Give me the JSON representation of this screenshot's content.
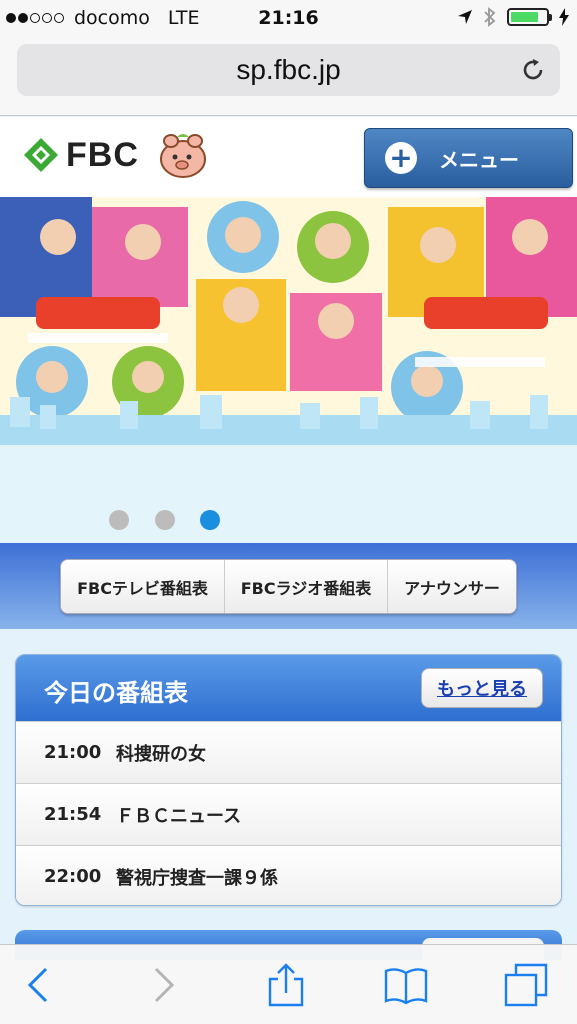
{
  "status_bar": {
    "carrier": "docomo",
    "network": "LTE",
    "time": "21:16",
    "signal_bars_filled": 2,
    "signal_bars_total": 5,
    "battery_level": 0.8
  },
  "browser": {
    "url": "sp.fbc.jp"
  },
  "header": {
    "logo_text": "FBC",
    "menu_label": "メニュー"
  },
  "banner": {
    "slides_total": 3,
    "active_slide": 3
  },
  "nav": {
    "items": [
      {
        "label": "FBCテレビ番組表"
      },
      {
        "label": "FBCラジオ番組表"
      },
      {
        "label": "アナウンサー"
      }
    ]
  },
  "schedule": {
    "title": "今日の番組表",
    "more_label": "もっと見る",
    "rows": [
      {
        "time": "21:00",
        "program": "科捜研の女"
      },
      {
        "time": "21:54",
        "program": "ＦＢＣニュース"
      },
      {
        "time": "22:00",
        "program": "警視庁捜査一課９係"
      }
    ]
  },
  "colors": {
    "accent_blue": "#2e6fd0",
    "menu_button": "#2a5f9f",
    "active_dot": "#1a8fe0",
    "logo_green": "#3aaa35"
  },
  "icons": [
    "back-icon",
    "forward-icon",
    "share-icon",
    "bookmarks-icon",
    "tabs-icon",
    "reload-icon",
    "location-icon",
    "bluetooth-icon",
    "battery-icon"
  ]
}
